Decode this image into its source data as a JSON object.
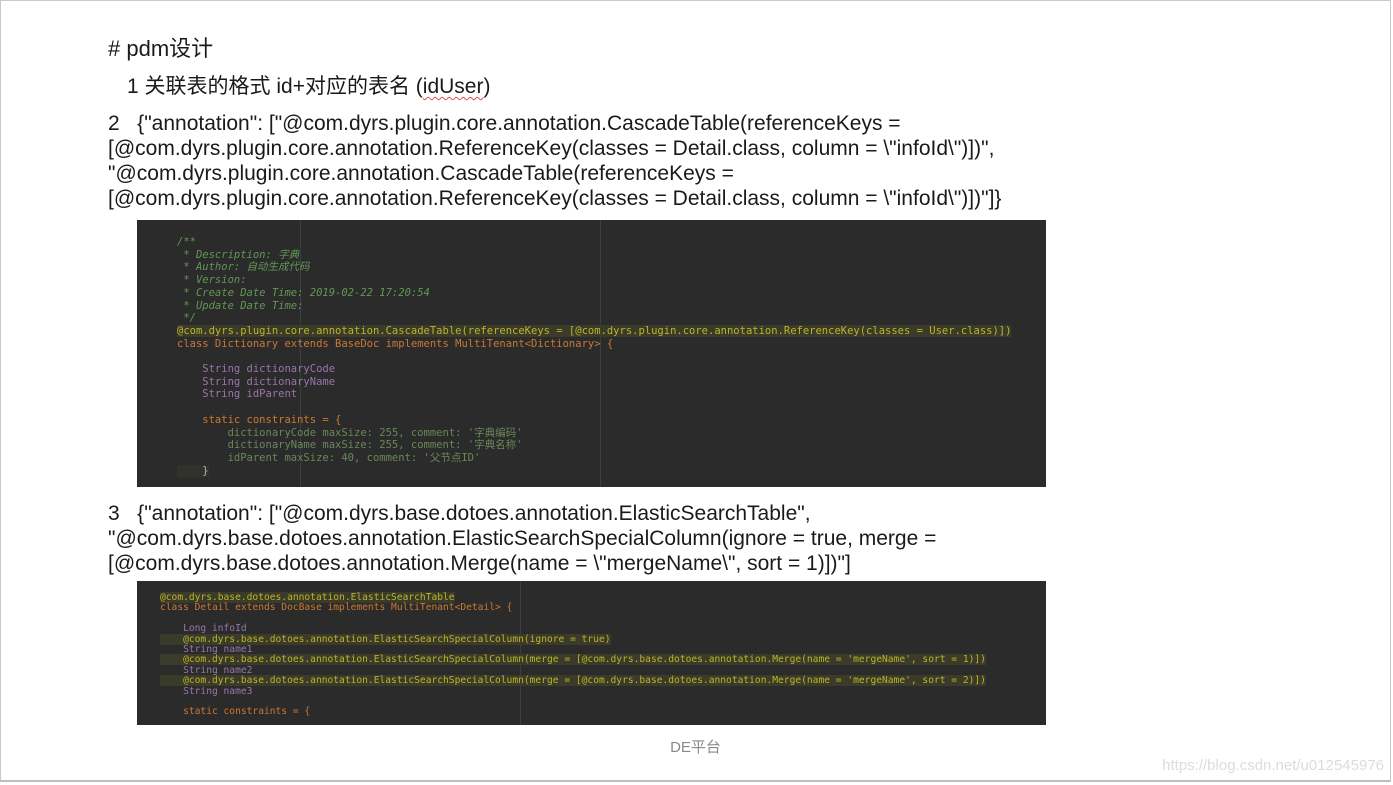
{
  "heading": "# pdm设计",
  "item1": {
    "prefix": "1  关联表的格式 id+对应的表名 (",
    "word": "idUser",
    "suffix": ")"
  },
  "item2": {
    "line1": "2   {\"annotation\": [\"@com.dyrs.plugin.core.annotation.CascadeTable(referenceKeys =",
    "line2": "[@com.dyrs.plugin.core.annotation.ReferenceKey(classes = Detail.class, column = \\\"infoId\\\")])\",",
    "line3": "\"@com.dyrs.plugin.core.annotation.CascadeTable(referenceKeys =",
    "line4": "[@com.dyrs.plugin.core.annotation.ReferenceKey(classes = Detail.class, column = \\\"infoId\\\")])\"]}"
  },
  "code1": {
    "lines": [
      "/**",
      " * Description: 字典",
      " * Author: 自动生成代码",
      " * Version:",
      " * Create Date Time: 2019-02-22 17:20:54",
      " * Update Date Time:",
      " */",
      "@com.dyrs.plugin.core.annotation.CascadeTable(referenceKeys = [@com.dyrs.plugin.core.annotation.ReferenceKey(classes = User.class)])",
      "class Dictionary extends BaseDoc implements MultiTenant<Dictionary> {",
      "",
      "    String dictionaryCode",
      "    String dictionaryName",
      "    String idParent",
      "",
      "    static constraints = {",
      "        dictionaryCode maxSize: 255, comment: '字典编码'",
      "        dictionaryName maxSize: 255, comment: '字典名称'",
      "        idParent maxSize: 40, comment: '父节点ID'",
      "    }"
    ]
  },
  "item3": {
    "line1": "3   {\"annotation\": [\"@com.dyrs.base.dotoes.annotation.ElasticSearchTable\",",
    "line2": "\"@com.dyrs.base.dotoes.annotation.ElasticSearchSpecialColumn(ignore = true, merge =",
    "line3": "[@com.dyrs.base.dotoes.annotation.Merge(name = \\\"mergeName\\\", sort = 1)])\"]"
  },
  "code2": {
    "lines": [
      "@com.dyrs.base.dotoes.annotation.ElasticSearchTable",
      "class Detail extends DocBase implements MultiTenant<Detail> {",
      "",
      "    Long infoId",
      "    @com.dyrs.base.dotoes.annotation.ElasticSearchSpecialColumn(ignore = true)",
      "    String name1",
      "    @com.dyrs.base.dotoes.annotation.ElasticSearchSpecialColumn(merge = [@com.dyrs.base.dotoes.annotation.Merge(name = 'mergeName', sort = 1)])",
      "    String name2",
      "    @com.dyrs.base.dotoes.annotation.ElasticSearchSpecialColumn(merge = [@com.dyrs.base.dotoes.annotation.Merge(name = 'mergeName', sort = 2)])",
      "    String name3",
      "",
      "    static constraints = {"
    ]
  },
  "footer": "DE平台",
  "watermark": "https://blog.csdn.net/u012545976"
}
